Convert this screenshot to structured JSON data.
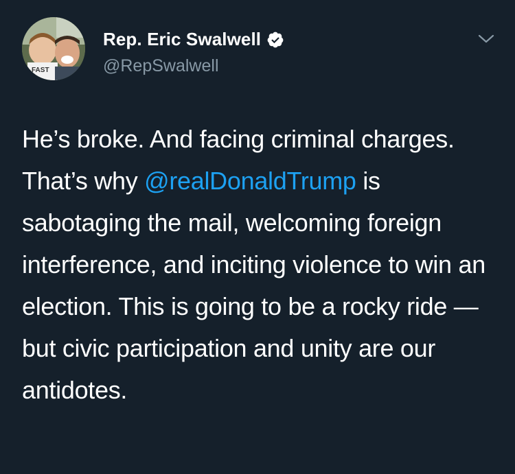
{
  "author": {
    "display_name": "Rep. Eric Swalwell",
    "handle": "@RepSwalwell",
    "verified": true,
    "avatar_icon": "user-avatar-photo"
  },
  "tweet": {
    "text_part1": "He’s broke. And facing criminal charges. That’s why ",
    "mention": "@realDonaldTrump",
    "text_part2": " is sabotaging the mail, welcoming foreign interference, and inciting violence to win an election. This is going to be a rocky ride — but civic participation and unity are our antidotes."
  },
  "icons": {
    "verified": "verified-badge-icon",
    "menu": "chevron-down-icon"
  },
  "colors": {
    "background": "#15202b",
    "text": "#ffffff",
    "secondary_text": "#8899a6",
    "link": "#1da1f2"
  }
}
